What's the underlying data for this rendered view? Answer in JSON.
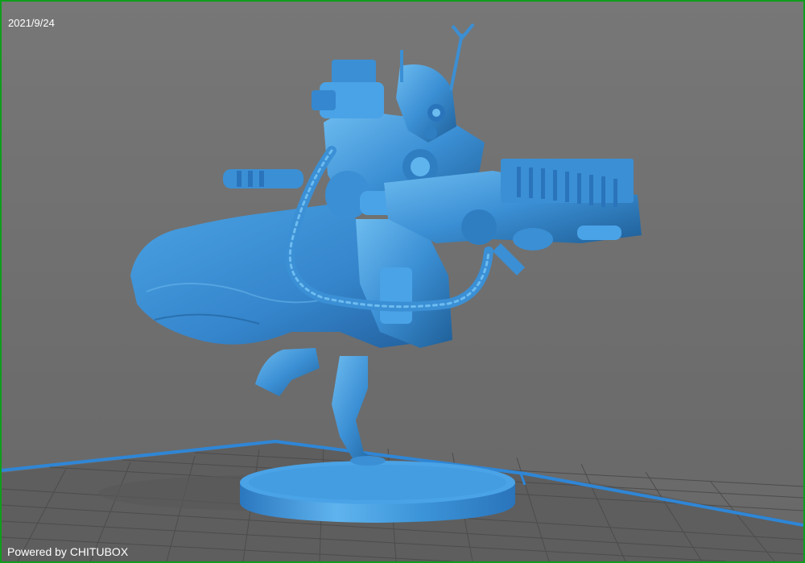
{
  "viewer": {
    "date": "2021/9/24",
    "powered_by": "Powered by CHITUBOX"
  },
  "colors": {
    "frame": "#0f9d1c",
    "background": "#707070",
    "model": "#3b8fd4",
    "model_highlight": "#6dbcf0",
    "model_shadow": "#1f5f98",
    "plate_grid": "#4f4f4f",
    "plate_edge": "#2f86d6"
  }
}
